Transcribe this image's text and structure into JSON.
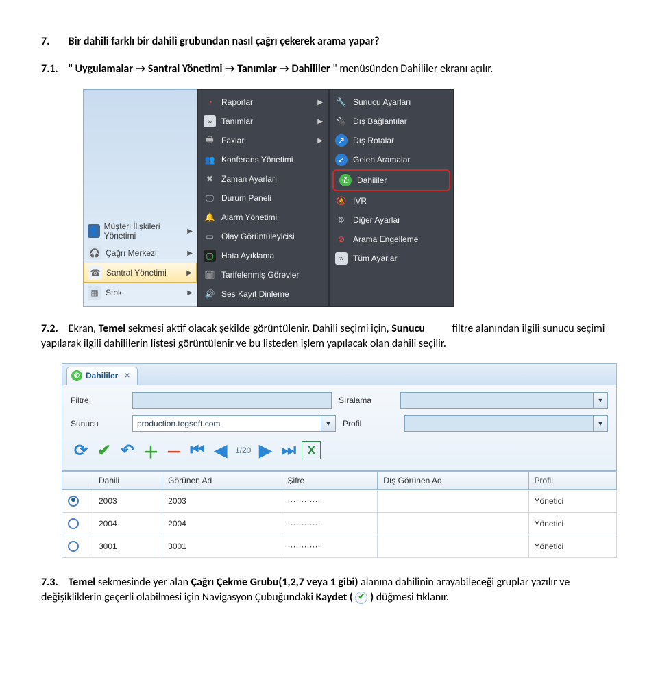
{
  "doc": {
    "q7_num": "7.",
    "q7_text": "Bir dahili farklı bir dahili grubundan nasıl çağrı çekerek arama yapar?",
    "p71_num": "7.1.",
    "p71_open_q": "\"",
    "p71_a": "Uygulamalar",
    "p71_b": "Santral Yönetimi",
    "p71_c": "Tanımlar",
    "p71_d": "Dahililer",
    "p71_close_q": "\"",
    "p71_tail1": " menüsünden ",
    "p71_link": "Dahililer",
    "p71_tail2": " ekranı açılır.",
    "arrow": " → ",
    "p72_num": "7.2.",
    "p72_a": "Ekran, ",
    "p72_b": "Temel",
    "p72_c": " sekmesi aktif olacak şekilde görüntülenir. Dahili seçimi için, ",
    "p72_d": "Sunucu",
    "p72_e": " filtre alanından ilgili sunucu seçimi yapılarak ilgili dahililerin listesi görüntülenir ve bu listeden işlem yapılacak olan dahili seçilir.",
    "p73_num": "7.3.",
    "p73_a": "Temel",
    "p73_b": " sekmesinde yer alan ",
    "p73_c": "Çağrı Çekme Grubu(1,2,7 veya 1 gibi)",
    "p73_d": " alanına dahilinin arayabileceği gruplar yazılır ve değişikliklerin geçerli olabilmesi için Navigasyon Çubuğundaki ",
    "p73_e": "Kaydet ( ",
    "p73_f": " )",
    "p73_g": " düğmesi tıklanır."
  },
  "shot1": {
    "left": {
      "item1": "Müşteri İlişkileri Yönetimi",
      "item2": "Çağrı Merkezi",
      "item3": "Santral Yönetimi",
      "item4": "Stok"
    },
    "mid": {
      "i1": "Raporlar",
      "i2": "Tanımlar",
      "i3": "Faxlar",
      "i4": "Konferans Yönetimi",
      "i5": "Zaman Ayarları",
      "i6": "Durum Paneli",
      "i7": "Alarm Yönetimi",
      "i8": "Olay Görüntüleyicisi",
      "i9": "Hata Ayıklama",
      "i10": "Tarifelenmiş Görevler",
      "i11": "Ses Kayıt Dinleme"
    },
    "right": {
      "r1": "Sunucu Ayarları",
      "r2": "Dış Bağlantılar",
      "r3": "Dış Rotalar",
      "r4": "Gelen Aramalar",
      "r5": "Dahililer",
      "r6": "IVR",
      "r7": "Diğer Ayarlar",
      "r8": "Arama Engelleme",
      "r9": "Tüm Ayarlar"
    }
  },
  "shot2": {
    "tab_label": "Dahililer",
    "filter": {
      "l_filtre": "Filtre",
      "l_siralama": "Sıralama",
      "l_sunucu": "Sunucu",
      "l_profil": "Profil",
      "sunucu_val": "production.tegsoft.com"
    },
    "pager": "1/20",
    "grid": {
      "h1": "Dahili",
      "h2": "Görünen Ad",
      "h3": "Şifre",
      "h4": "Dış Görünen Ad",
      "h5": "Profil",
      "rows": [
        {
          "sel": true,
          "c1": "2003",
          "c2": "2003",
          "c3": "············",
          "c4": "",
          "c5": "Yönetici"
        },
        {
          "sel": false,
          "c1": "2004",
          "c2": "2004",
          "c3": "············",
          "c4": "",
          "c5": "Yönetici"
        },
        {
          "sel": false,
          "c1": "3001",
          "c2": "3001",
          "c3": "············",
          "c4": "",
          "c5": "Yönetici"
        }
      ]
    }
  }
}
